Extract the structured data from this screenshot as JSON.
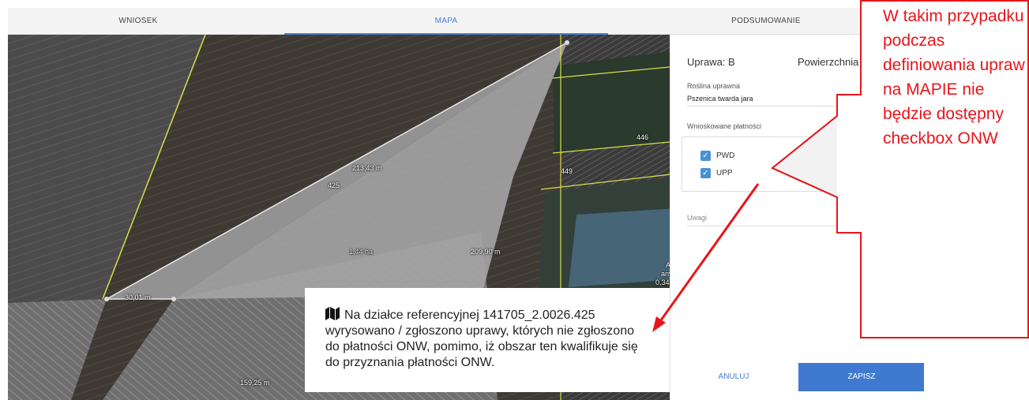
{
  "tabs": [
    {
      "label": "WNIOSEK",
      "active": false
    },
    {
      "label": "MAPA",
      "active": true
    },
    {
      "label": "PODSUMOWANIE",
      "active": false
    }
  ],
  "map": {
    "labels": {
      "edge_top": "213,43 m",
      "parcel_425": "425",
      "area": "1,44 ha",
      "edge_right": "209,90 m",
      "edge_left": "30,01 m",
      "edge_bottom": "159,25 m",
      "parcel_449": "449",
      "parcel_446": "446",
      "partial_a": "A",
      "partial_any": "any",
      "partial_num": "0,34"
    }
  },
  "panel": {
    "crop_label": "Uprawa: B",
    "area_label": "Powierzchnia",
    "plant_label": "Roślina uprawna",
    "plant_value": "Pszenica twarda jara",
    "payments_label": "Wnioskowane płatności",
    "payments": [
      {
        "label": "PWD",
        "checked": true
      },
      {
        "label": "UPP",
        "checked": true
      }
    ],
    "remarks_label": "Uwagi",
    "cancel_label": "ANULUJ",
    "save_label": "ZAPISZ"
  },
  "tooltip": {
    "icon": "map-icon",
    "text": "Na działce referencyjnej 141705_2.0026.425 wyrysowano / zgłoszono uprawy, których nie zgłoszono do płatności ONW, pomimo, iż obszar ten kwalifikuje się do przyznania płatności ONW."
  },
  "annotation": {
    "color": "#e8151b",
    "text": "W takim przypadku podczas definiowania upraw na MAPIE nie będzie dostępny checkbox ONW"
  }
}
